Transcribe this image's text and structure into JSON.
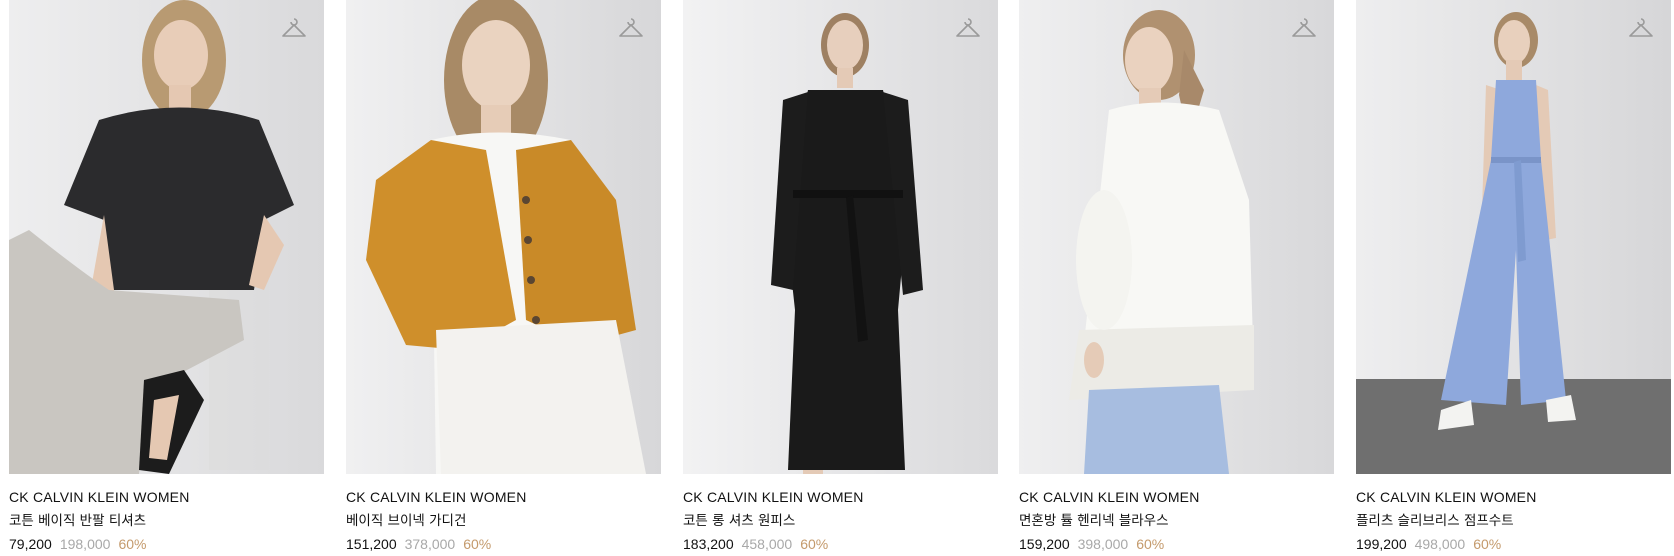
{
  "products": [
    {
      "brand": "CK CALVIN KLEIN WOMEN",
      "name": "코튼 베이직 반팔 티셔츠",
      "price": "79,200",
      "original_price": "198,000",
      "discount": "60%",
      "wishlist_icon": "hanger-icon"
    },
    {
      "brand": "CK CALVIN KLEIN WOMEN",
      "name": "베이직 브이넥 가디건",
      "price": "151,200",
      "original_price": "378,000",
      "discount": "60%",
      "wishlist_icon": "hanger-icon"
    },
    {
      "brand": "CK CALVIN KLEIN WOMEN",
      "name": "코튼 롱 셔츠 원피스",
      "price": "183,200",
      "original_price": "458,000",
      "discount": "60%",
      "wishlist_icon": "hanger-icon"
    },
    {
      "brand": "CK CALVIN KLEIN WOMEN",
      "name": "면혼방 튤 헨리넥 블라우스",
      "price": "159,200",
      "original_price": "398,000",
      "discount": "60%",
      "wishlist_icon": "hanger-icon"
    },
    {
      "brand": "CK CALVIN KLEIN WOMEN",
      "name": "플리츠 슬리브리스 점프수트",
      "price": "199,200",
      "original_price": "498,000",
      "discount": "60%",
      "wishlist_icon": "hanger-icon"
    }
  ],
  "colors": {
    "price": "#111111",
    "original_price": "#a8a8a8",
    "discount": "#c49a6c",
    "image_background": "#e9e9ea"
  }
}
